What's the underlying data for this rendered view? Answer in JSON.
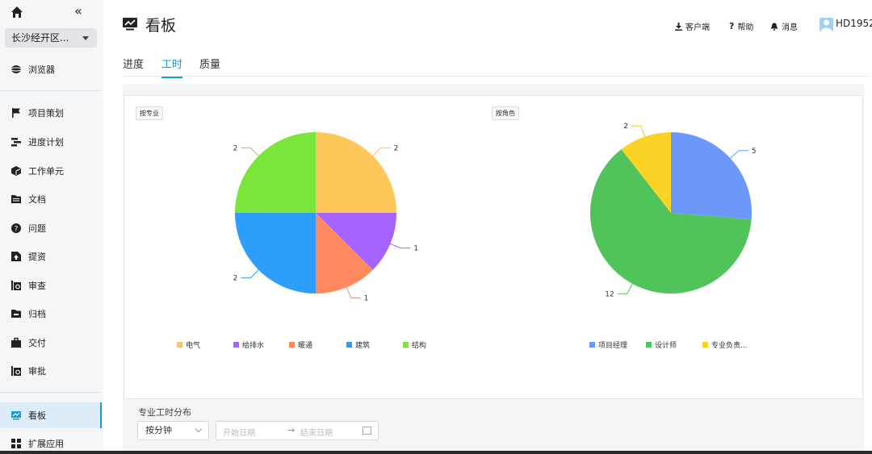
{
  "sidebar": {
    "project": "长沙经开区...",
    "items": [
      {
        "label": "浏览器",
        "icon": "browser-icon"
      },
      {
        "label": "项目策划",
        "icon": "flag-icon"
      },
      {
        "label": "进度计划",
        "icon": "schedule-icon"
      },
      {
        "label": "工作单元",
        "icon": "cube-icon"
      },
      {
        "label": "文档",
        "icon": "folder-icon"
      },
      {
        "label": "问题",
        "icon": "question-icon"
      },
      {
        "label": "提资",
        "icon": "upload-icon"
      },
      {
        "label": "审查",
        "icon": "review-icon"
      },
      {
        "label": "归档",
        "icon": "archive-icon"
      },
      {
        "label": "交付",
        "icon": "briefcase-icon"
      },
      {
        "label": "审批",
        "icon": "approve-icon"
      },
      {
        "label": "看板",
        "icon": "dashboard-icon"
      },
      {
        "label": "扩展应用",
        "icon": "apps-icon"
      }
    ]
  },
  "header": {
    "title": "看板",
    "client_label": "客户端",
    "help_label": "帮助",
    "messages_label": "消息",
    "username": "HD1952"
  },
  "tabs": [
    {
      "label": "进度"
    },
    {
      "label": "工时"
    },
    {
      "label": "质量"
    }
  ],
  "colors": {
    "accent": "#1a9bd7",
    "电气": "#ffc65a",
    "给排水": "#a564ff",
    "暖通": "#ff8a5f",
    "建筑": "#2e9efc",
    "结构": "#7ae63c",
    "项目经理": "#6d98fb",
    "设计师": "#50c45a",
    "专业负责人": "#fad326"
  },
  "chart_data": [
    {
      "type": "pie",
      "title": "按专业",
      "labels": [
        "电气",
        "给排水",
        "暖通",
        "建筑",
        "结构"
      ],
      "legend": [
        "电气",
        "给排水",
        "暖通",
        "建筑",
        "结构"
      ],
      "values": [
        2,
        1,
        1,
        2,
        2
      ],
      "legend_position": "bottom"
    },
    {
      "type": "pie",
      "title": "按角色",
      "labels": [
        "项目经理",
        "设计师",
        "专业负责人"
      ],
      "legend": [
        "项目经理",
        "设计师",
        "专业负责..."
      ],
      "values": [
        5,
        12,
        2
      ],
      "legend_position": "bottom"
    }
  ],
  "section": {
    "title": "专业工时分布",
    "unit_select": "按分钟",
    "start_placeholder": "开始日期",
    "end_placeholder": "结束日期"
  }
}
